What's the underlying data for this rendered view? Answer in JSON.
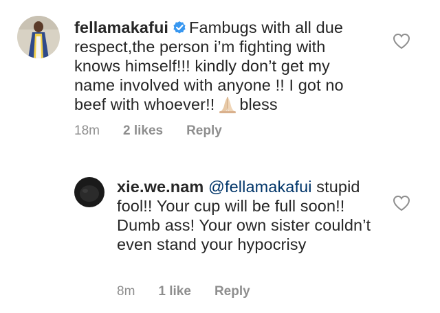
{
  "comments": [
    {
      "username": "fellamakafui",
      "verified": true,
      "text_before_emoji": "Fambugs with all due respect,the person i’m fighting with knows himself!!! kindly don’t get my name involved with anyone !! I got no beef with whoever!!",
      "text_after_emoji": "bless",
      "emoji": "folded-hands",
      "time": "18m",
      "likes": "2 likes",
      "reply": "Reply"
    },
    {
      "username": "xie.we.nam",
      "mention": "@fellamakafui",
      "text": "stupid fool!! Your cup will be full soon!! Dumb ass! Your own sister couldn’t even stand your hypocrisy",
      "time": "8m",
      "likes": "1 like",
      "reply": "Reply"
    }
  ],
  "icons": {
    "verified": "verified-badge-icon",
    "like": "heart-outline-icon"
  },
  "colors": {
    "text": "#262626",
    "meta": "#8e8e8e",
    "mention": "#003569",
    "verified": "#3897f0"
  }
}
